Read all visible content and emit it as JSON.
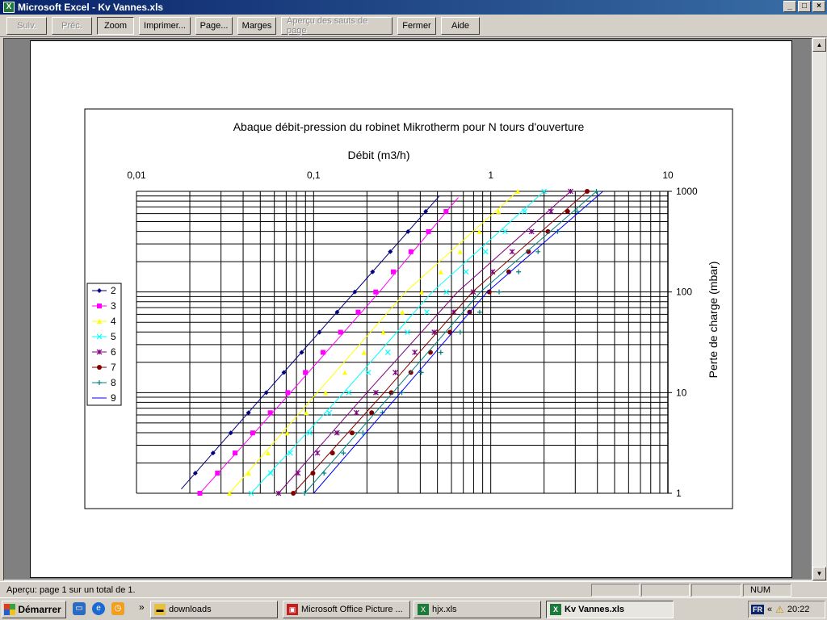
{
  "window": {
    "title": "Microsoft Excel - Kv Vannes.xls",
    "app_icon": "excel-icon",
    "minimize": "_",
    "maximize": "□",
    "close": "×"
  },
  "toolbar": {
    "buttons": [
      {
        "label": "Suiv.",
        "enabled": false
      },
      {
        "label": "Préc.",
        "enabled": false
      },
      {
        "label": "Zoom",
        "enabled": true
      },
      {
        "label": "Imprimer...",
        "enabled": true
      },
      {
        "label": "Page...",
        "enabled": true
      },
      {
        "label": "Marges",
        "enabled": true
      },
      {
        "label": "Aperçu des sauts de page",
        "enabled": false
      },
      {
        "label": "Fermer",
        "enabled": true
      },
      {
        "label": "Aide",
        "enabled": true
      }
    ]
  },
  "status": {
    "text": "Aperçu: page 1 sur un total de 1.",
    "num": "NUM"
  },
  "taskbar": {
    "start": "Démarrer",
    "chevron": "»",
    "tasks": [
      {
        "label": "downloads",
        "icon": "folder-icon"
      },
      {
        "label": "Microsoft Office Picture ...",
        "icon": "picture-manager-icon"
      },
      {
        "label": "hjx.xls",
        "icon": "excel-icon"
      },
      {
        "label": "Kv Vannes.xls",
        "icon": "excel-icon",
        "active": true
      }
    ],
    "tray": {
      "lang": "FR",
      "chevron": "«",
      "clock": "20:22"
    }
  },
  "chart_data": {
    "type": "line",
    "title": "Abaque débit-pression du robinet Mikrotherm pour N tours d'ouverture",
    "xlabel": "Débit (m3/h)",
    "ylabel": "Perte de charge (mbar)",
    "xscale": "log",
    "yscale": "log",
    "xlim": [
      0.01,
      10
    ],
    "ylim": [
      1,
      1000
    ],
    "x_ticks": [
      "0,01",
      "0,1",
      "1",
      "10"
    ],
    "y_ticks": [
      "1",
      "10",
      "100",
      "1000"
    ],
    "x_axis_position": "top",
    "y_axis_position": "right",
    "grid": true,
    "legend": "left",
    "series": [
      {
        "name": "2",
        "color": "#000080",
        "marker": "diamond",
        "x": [
          0.0179,
          0.0538,
          0.179,
          0.513
        ],
        "y": [
          1.1,
          10,
          110,
          900
        ]
      },
      {
        "name": "3",
        "color": "#ff00ff",
        "marker": "square",
        "x": [
          0.0228,
          0.0741,
          0.235,
          0.656
        ],
        "y": [
          1.0,
          10,
          100,
          870
        ]
      },
      {
        "name": "4",
        "color": "#ffff00",
        "marker": "triangle",
        "x": [
          0.0335,
          0.105,
          0.331,
          1.42
        ],
        "y": [
          1.0,
          10,
          100,
          1000
        ]
      },
      {
        "name": "5",
        "color": "#00ffff",
        "marker": "x",
        "x": [
          0.0444,
          0.148,
          0.467,
          2.0
        ],
        "y": [
          1.0,
          10,
          100,
          1000
        ]
      },
      {
        "name": "6",
        "color": "#800080",
        "marker": "star",
        "x": [
          0.0634,
          0.2,
          0.65,
          2.82
        ],
        "y": [
          1.0,
          10,
          100,
          1000
        ]
      },
      {
        "name": "7",
        "color": "#800000",
        "marker": "circle",
        "x": [
          0.0768,
          0.25,
          0.788,
          3.5
        ],
        "y": [
          1.0,
          10,
          100,
          1000
        ]
      },
      {
        "name": "8",
        "color": "#008080",
        "marker": "plus",
        "x": [
          0.0889,
          0.28,
          0.875,
          3.95
        ],
        "y": [
          1.0,
          10,
          100,
          1000
        ]
      },
      {
        "name": "9",
        "color": "#0000ff",
        "marker": "none",
        "x": [
          0.1,
          0.31,
          0.955,
          4.3
        ],
        "y": [
          1.0,
          10,
          100,
          1000
        ]
      }
    ]
  }
}
